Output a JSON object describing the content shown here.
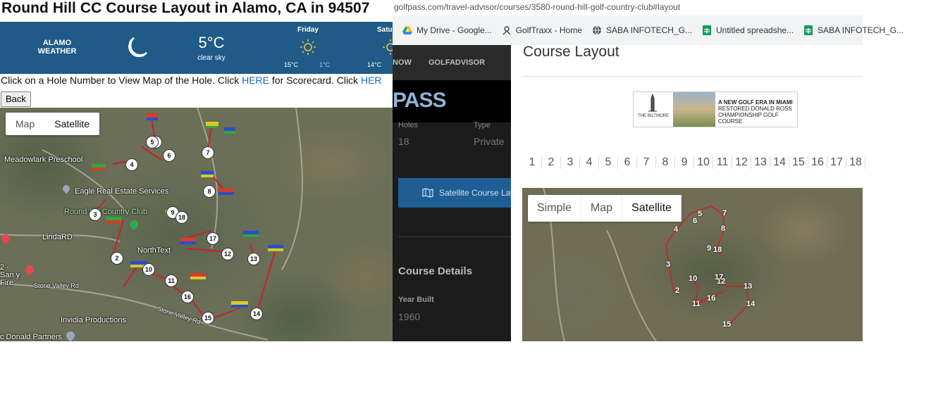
{
  "left_page": {
    "title": "Round Hill CC Course Layout in Alamo, CA in 94507",
    "weather": {
      "brand_line1": "ALAMO",
      "brand_line2": "WEATHER",
      "temperature": "5°C",
      "condition": "clear sky",
      "forecast": [
        {
          "day": "Friday",
          "high": "15°C",
          "low": "1°C"
        },
        {
          "day": "Satu",
          "high": "14°C",
          "low": ""
        }
      ]
    },
    "instructions": {
      "part1": "Click on a Hole Number to View Map of the Hole. Click ",
      "link1": "HERE",
      "part2": " for Scorecard. Click ",
      "link2": "HER"
    },
    "back_label": "Back",
    "map": {
      "toggle_map": "Map",
      "toggle_satellite": "Satellite",
      "selected": "Satellite",
      "places": [
        {
          "id": "meadowlark",
          "label": "Meadowlark Preschool"
        },
        {
          "id": "eagle",
          "label": "Eagle Real Estate Services"
        },
        {
          "id": "roundhill",
          "label": "Round Hill Country Club"
        },
        {
          "id": "lindard",
          "label": "LindaRD"
        },
        {
          "id": "northtext",
          "label": "NorthText"
        },
        {
          "id": "sanfire",
          "label": "2 - San y Fire"
        },
        {
          "id": "stonevalley1",
          "label": "Stone Valley Rd"
        },
        {
          "id": "stonevalley2",
          "label": "Stone Valley Rd"
        },
        {
          "id": "invidia",
          "label": "Invidia Productions"
        },
        {
          "id": "mcdonald",
          "label": "c Donald Partners"
        }
      ],
      "holes": [
        "1",
        "2",
        "3",
        "4",
        "5",
        "6",
        "7",
        "8",
        "9",
        "10",
        "11",
        "12",
        "13",
        "14",
        "15",
        "16",
        "17",
        "18"
      ]
    }
  },
  "browser": {
    "url": "golfpass.com/travel-advisor/courses/3580-round-hill-golf-country-club#layout",
    "bookmarks": [
      {
        "label": "My Drive - Google...",
        "icon": "google-drive-icon"
      },
      {
        "label": "GolfTraxx - Home",
        "icon": "golftraxx-icon"
      },
      {
        "label": "SABA INFOTECH_G...",
        "icon": "globe-icon"
      },
      {
        "label": "Untitled spreadshe...",
        "icon": "sheets-icon"
      },
      {
        "label": "SABA INFOTECH_G...",
        "icon": "sheets-icon"
      }
    ]
  },
  "golfpass": {
    "nav": [
      "NOW",
      "GOLFADVISOR"
    ],
    "logo_text": "PASS",
    "holes_label": "Holes",
    "holes_value": "18",
    "type_label": "Type",
    "type_value": "Private",
    "satellite_button": "Satellite Course Layout",
    "course_details_heading": "Course Details",
    "year_built_label": "Year Built",
    "year_built_value": "1960",
    "layout_heading": "Course Layout",
    "ad": {
      "headline": "A NEW GOLF ERA IN MIAMI",
      "line2": "RESTORED DONALD ROSS",
      "line3": "CHAMPIONSHIP GOLF COURSE",
      "brand": "THE BILTMORE"
    },
    "hole_tabs": [
      "1",
      "2",
      "3",
      "4",
      "5",
      "6",
      "7",
      "8",
      "9",
      "10",
      "11",
      "12",
      "13",
      "14",
      "15",
      "16",
      "17",
      "18"
    ],
    "map": {
      "toggle_simple": "Simple",
      "toggle_map": "Map",
      "toggle_satellite": "Satellite",
      "selected": "Satellite"
    }
  }
}
